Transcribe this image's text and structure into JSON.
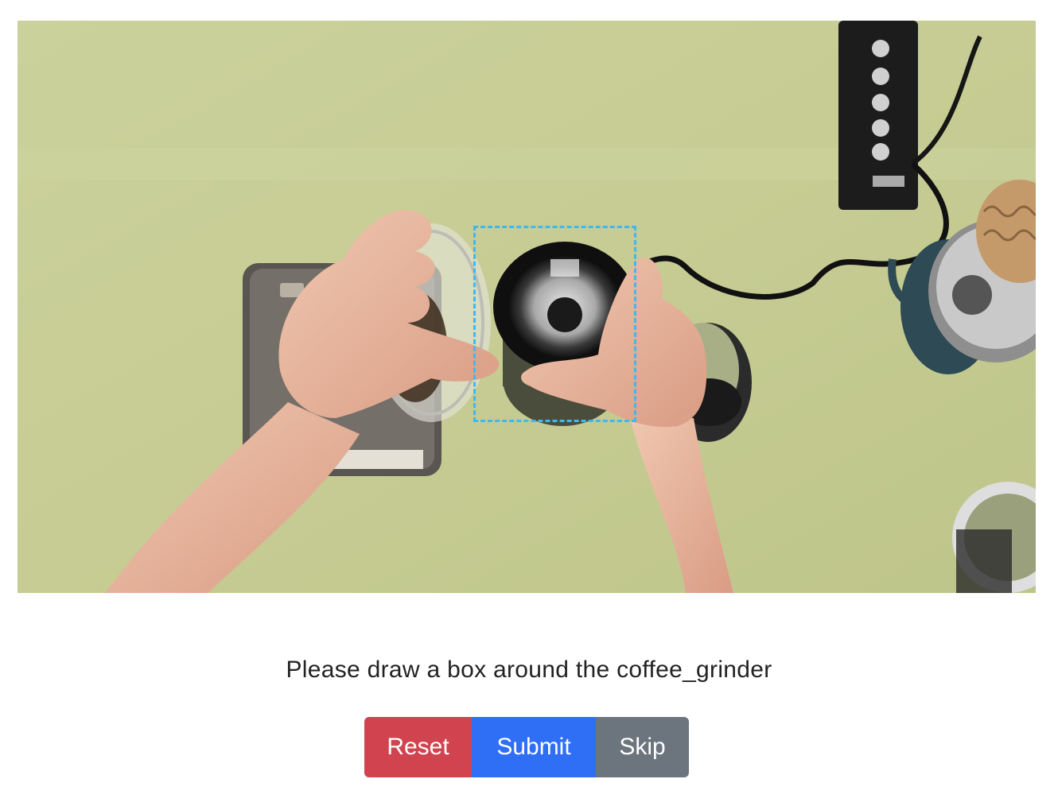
{
  "task": {
    "instruction": "Please draw a box around the coffee_grinder",
    "target_label": "coffee_grinder"
  },
  "canvas": {
    "scene": "Top-down view of hands pouring coffee beans into a coffee grinder on a green tablecloth"
  },
  "buttons": {
    "reset_label": "Reset",
    "submit_label": "Submit",
    "skip_label": "Skip"
  },
  "colors": {
    "reset": "#d1434f",
    "submit": "#2f6ff6",
    "skip": "#6c757d",
    "bbox_stroke": "#3fb8f0",
    "tablecloth": "#c9cf98"
  }
}
